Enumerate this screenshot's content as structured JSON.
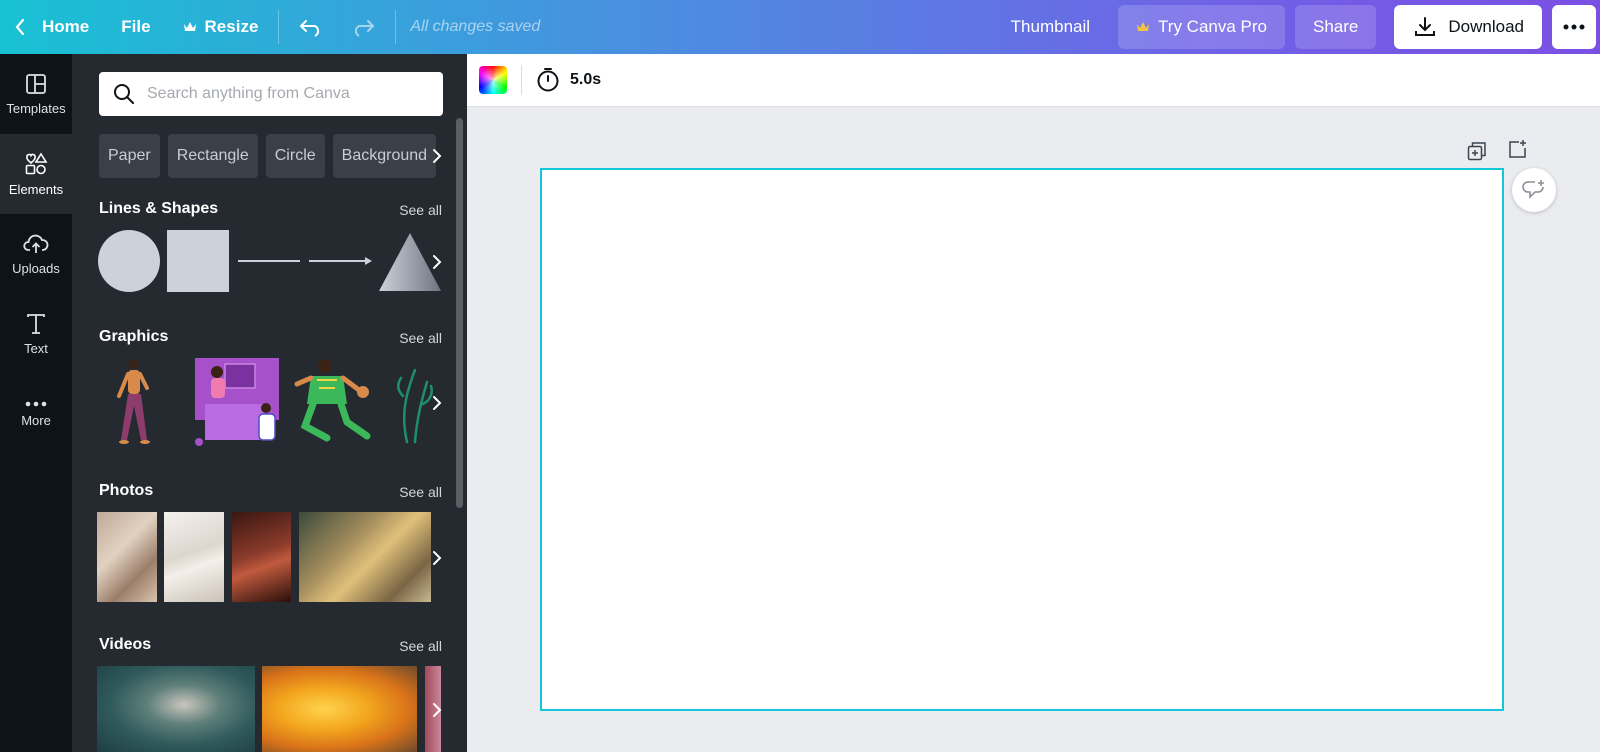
{
  "topbar": {
    "home_label": "Home",
    "file_label": "File",
    "resize_label": "Resize",
    "saved_status": "All changes saved",
    "thumbnail_label": "Thumbnail",
    "pro_label": "Try Canva Pro",
    "share_label": "Share",
    "download_label": "Download",
    "crown_color": "#f5c342"
  },
  "rail": {
    "items": [
      {
        "label": "Templates",
        "icon": "templates-icon"
      },
      {
        "label": "Elements",
        "icon": "elements-icon"
      },
      {
        "label": "Uploads",
        "icon": "upload-cloud-icon"
      },
      {
        "label": "Text",
        "icon": "text-icon"
      },
      {
        "label": "More",
        "icon": "more-dots-icon"
      }
    ],
    "active": "Elements"
  },
  "panel": {
    "search_placeholder": "Search anything from Canva",
    "chips": [
      "Paper",
      "Rectangle",
      "Circle",
      "Background"
    ],
    "sections": {
      "lines_shapes": {
        "title": "Lines & Shapes",
        "see_all": "See all"
      },
      "graphics": {
        "title": "Graphics",
        "see_all": "See all"
      },
      "photos": {
        "title": "Photos",
        "see_all": "See all"
      },
      "videos": {
        "title": "Videos",
        "see_all": "See all"
      }
    }
  },
  "editor": {
    "duration": "5.0s",
    "accent": "#13c6d8"
  }
}
